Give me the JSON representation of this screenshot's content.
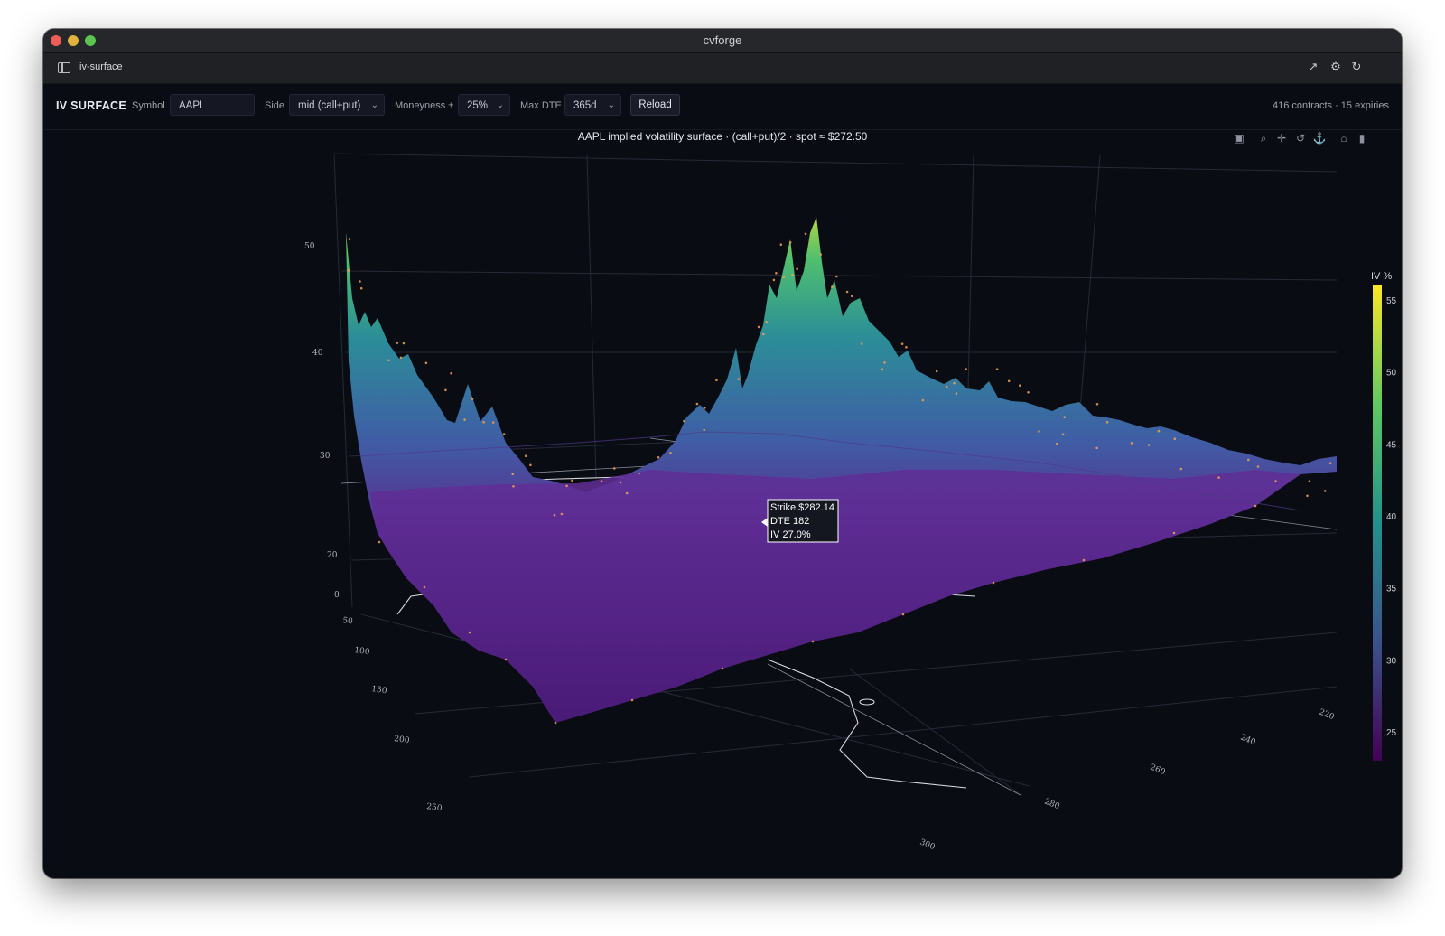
{
  "window": {
    "title": "cvforge"
  },
  "tab": {
    "label": "iv-surface"
  },
  "icons": {
    "sidebar": "sidebar-toggle-icon",
    "external": "external-link-icon",
    "settings": "gear-icon",
    "refresh": "refresh-icon"
  },
  "toolbar": {
    "title": "IV SURFACE",
    "symbol_label": "Symbol",
    "symbol_value": "AAPL",
    "side_label": "Side",
    "side_value": "mid (call+put)",
    "moneyness_label": "Moneyness ±",
    "moneyness_value": "25%",
    "maxdte_label": "Max DTE",
    "maxdte_value": "365d",
    "reload_label": "Reload",
    "summary": "416 contracts · 15 expiries"
  },
  "modebar": [
    "camera-icon",
    "zoom-icon",
    "pan-icon",
    "orbit-icon",
    "turntable-icon",
    "home-icon",
    "camera-save-icon"
  ],
  "chart_data": {
    "type": "surface",
    "title": "AAPL implied volatility surface · (call+put)/2 · spot ≈ $272.50",
    "x_axis": {
      "label": "",
      "ticks": [
        "220",
        "240",
        "260",
        "280",
        "300"
      ]
    },
    "y_axis": {
      "label": "",
      "ticks": [
        "0",
        "50",
        "100",
        "150",
        "200",
        "250"
      ]
    },
    "z_axis": {
      "label": "",
      "ticks": [
        "20",
        "30",
        "40",
        "50"
      ]
    },
    "colorbar": {
      "title": "IV %",
      "ticks": [
        "25",
        "30",
        "35",
        "40",
        "45",
        "50",
        "55"
      ],
      "range": [
        23,
        56
      ],
      "colors": [
        "#440154",
        "#3b528b",
        "#21918c",
        "#5ec962",
        "#fde725"
      ]
    },
    "tooltip": {
      "strike": "Strike $282.14",
      "dte": "DTE 182",
      "iv": "IV 27.0%"
    },
    "ridge_profile": {
      "dte_axis": [
        0,
        50,
        100,
        150,
        200,
        250
      ],
      "iv_near_strike_220": [
        52,
        44,
        38,
        34,
        31,
        30
      ],
      "iv_near_strike_272": [
        57,
        42,
        34,
        31,
        29,
        28
      ],
      "iv_near_strike_300": [
        31,
        29,
        28,
        27,
        27,
        26
      ]
    }
  }
}
